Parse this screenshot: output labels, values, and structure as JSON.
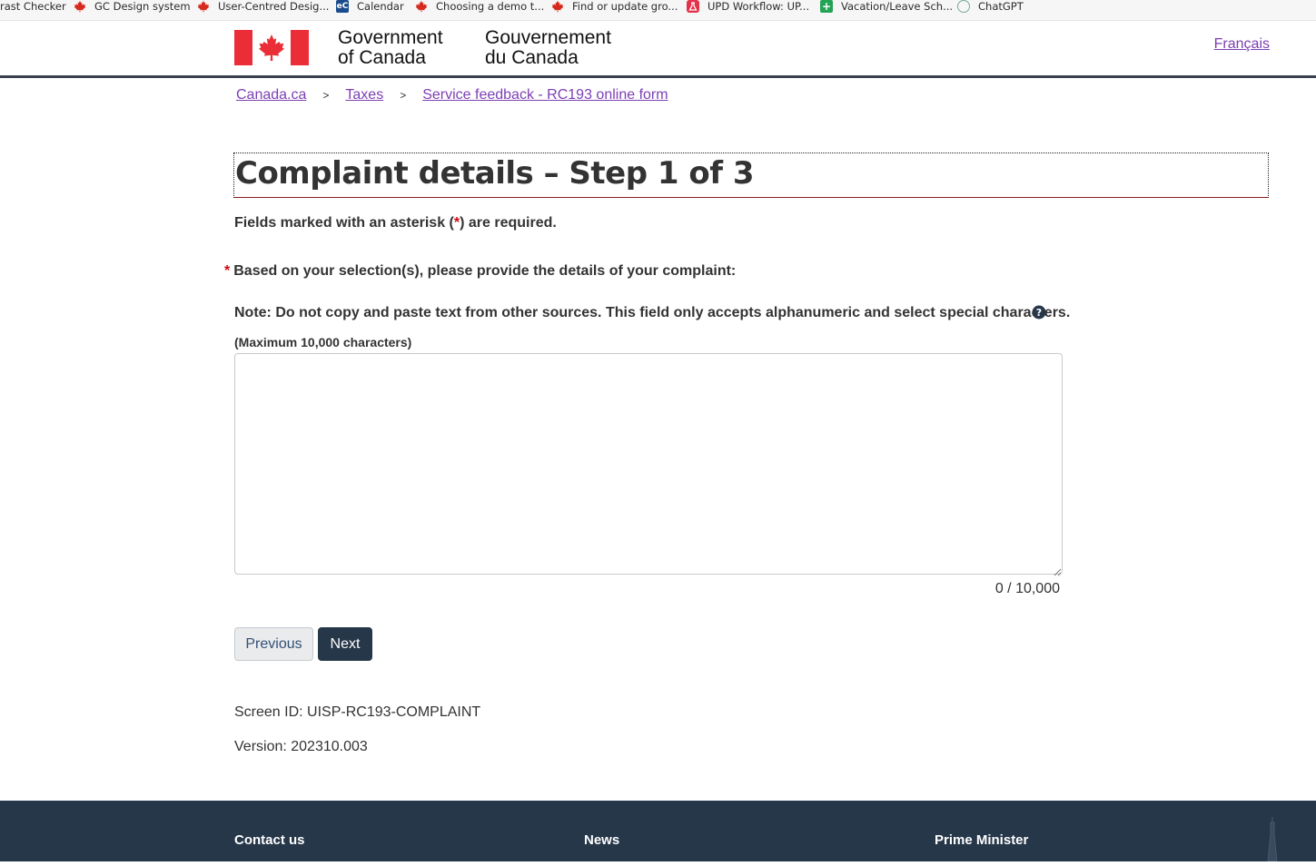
{
  "bookmarks": [
    {
      "label": "rast Checker",
      "icon": "none"
    },
    {
      "label": "GC Design system",
      "icon": "maple-leaf-icon"
    },
    {
      "label": "User-Centred Desig...",
      "icon": "maple-leaf-icon"
    },
    {
      "label": "Calendar",
      "icon": "ec-icon",
      "icon_text": "eC"
    },
    {
      "label": "Choosing a demo t...",
      "icon": "maple-leaf-icon"
    },
    {
      "label": "Find or update gro...",
      "icon": "maple-leaf-icon"
    },
    {
      "label": "UPD Workflow: UP...",
      "icon": "flask-icon"
    },
    {
      "label": "Vacation/Leave Sch...",
      "icon": "sheet-icon"
    },
    {
      "label": "ChatGPT",
      "icon": "chatgpt-icon"
    }
  ],
  "header": {
    "gov_en_line1": "Government",
    "gov_en_line2": "of Canada",
    "gov_fr_line1": "Gouvernement",
    "gov_fr_line2": "du Canada",
    "language_toggle": "Français"
  },
  "breadcrumb": {
    "items": [
      "Canada.ca",
      "Taxes",
      "Service feedback - RC193 online form"
    ],
    "separator": ">"
  },
  "form": {
    "title": "Complaint details – Step 1 of 3",
    "required_note_before": "Fields marked with an asterisk (",
    "required_note_asterisk": "*",
    "required_note_after": ") are required.",
    "question_asterisk": "*",
    "question": "Based on your selection(s), please provide the details of your complaint:",
    "note": "Note: Do not copy and paste text from other sources. This field only accepts alphanumeric and select special characters.",
    "max_chars": "(Maximum 10,000 characters)",
    "textarea_value": "",
    "counter": "0 / 10,000"
  },
  "buttons": {
    "previous": "Previous",
    "next": "Next"
  },
  "meta": {
    "screen_id": "Screen ID: UISP-RC193-COMPLAINT",
    "version": "Version: 202310.003"
  },
  "footer": {
    "links": [
      "Contact us",
      "News",
      "Prime Minister"
    ]
  },
  "colors": {
    "link": "#7c3fb3",
    "required": "#d3080c",
    "footer_bg": "#26374a",
    "flag_red": "#eb2d37"
  }
}
